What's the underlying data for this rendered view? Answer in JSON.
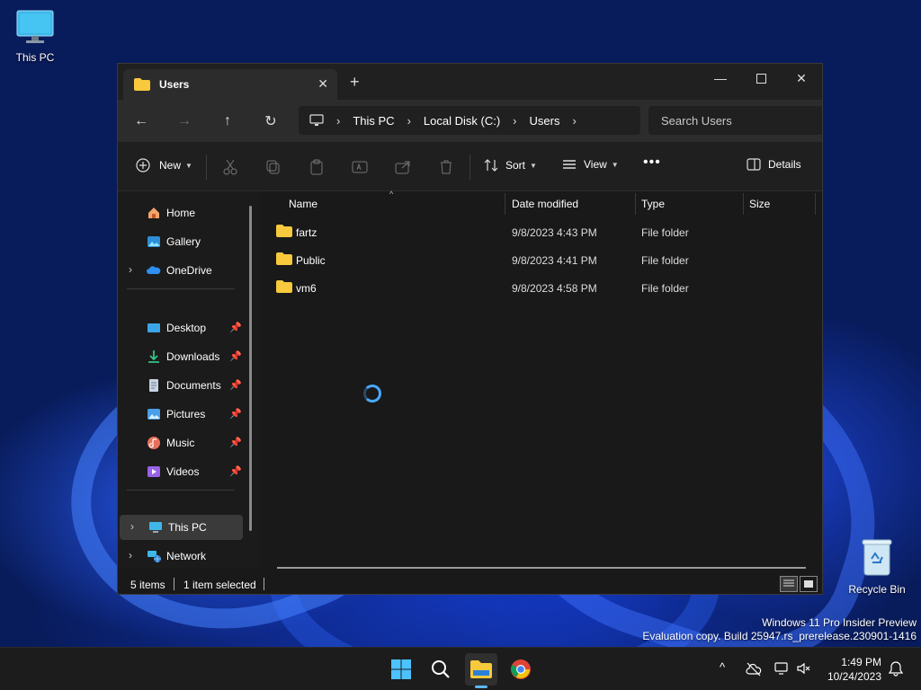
{
  "desktop": {
    "icons": [
      {
        "label": "This PC"
      },
      {
        "label": "Recycle Bin"
      }
    ],
    "watermark": {
      "line1": "Windows 11 Pro Insider Preview",
      "line2": "Evaluation copy. Build 25947.rs_prerelease.230901-1416"
    }
  },
  "window": {
    "tab": {
      "title": "Users"
    },
    "address": {
      "crumbs": [
        "This PC",
        "Local Disk (C:)",
        "Users"
      ]
    },
    "search": {
      "placeholder": "Search Users"
    },
    "commands": {
      "new": "New",
      "sort": "Sort",
      "view": "View",
      "details": "Details"
    },
    "sidebar": {
      "items": [
        {
          "label": "Home"
        },
        {
          "label": "Gallery"
        },
        {
          "label": "OneDrive"
        },
        {
          "label": "Desktop"
        },
        {
          "label": "Downloads"
        },
        {
          "label": "Documents"
        },
        {
          "label": "Pictures"
        },
        {
          "label": "Music"
        },
        {
          "label": "Videos"
        },
        {
          "label": "This PC"
        },
        {
          "label": "Network"
        }
      ]
    },
    "columns": {
      "name": "Name",
      "date": "Date modified",
      "type": "Type",
      "size": "Size"
    },
    "files": [
      {
        "name": "fartz",
        "date": "9/8/2023 4:43 PM",
        "type": "File folder"
      },
      {
        "name": "Public",
        "date": "9/8/2023 4:41 PM",
        "type": "File folder"
      },
      {
        "name": "vm6",
        "date": "9/8/2023 4:58 PM",
        "type": "File folder"
      }
    ],
    "status": {
      "count": "5 items",
      "selected": "1 item selected"
    }
  },
  "taskbar": {
    "clock": {
      "time": "1:49 PM",
      "date": "10/24/2023"
    }
  },
  "colors": {
    "accent": "#5cb8ff",
    "folder": "#f8c93d",
    "window_bg": "#191919"
  }
}
